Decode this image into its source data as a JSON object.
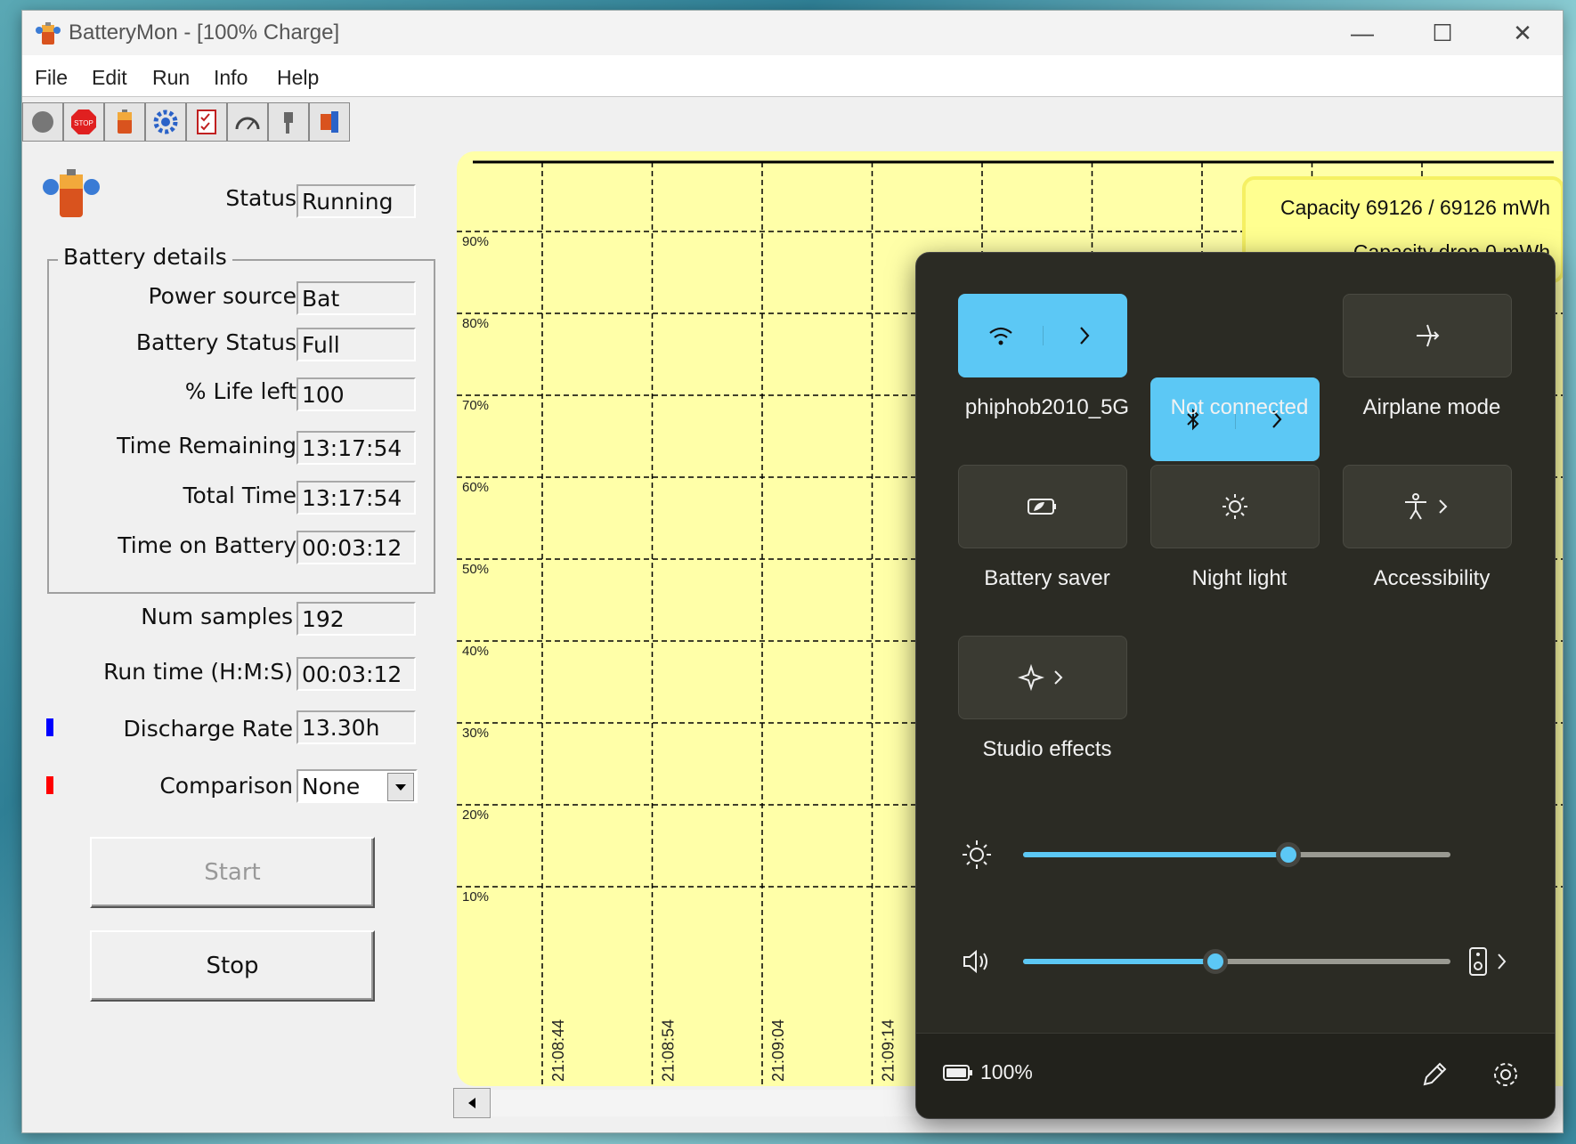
{
  "window": {
    "title": "BatteryMon - [100% Charge]",
    "controls": {
      "minimize": "—",
      "maximize": "☐",
      "close": "✕"
    }
  },
  "menu": {
    "items": [
      "File",
      "Edit",
      "Run",
      "Info",
      "Help"
    ]
  },
  "toolbar": {
    "buttons": [
      "stop-circle-icon",
      "stop-sign-icon",
      "battery-icon",
      "settings-icon",
      "checklist-icon",
      "gauge-icon",
      "plug-icon",
      "tools-icon"
    ]
  },
  "panel": {
    "status_label": "Status",
    "status_value": "Running",
    "group_title": "Battery details",
    "power_source_label": "Power source",
    "power_source_value": "Bat",
    "battery_status_label": "Battery Status",
    "battery_status_value": "Full",
    "life_left_label": "% Life left",
    "life_left_value": "100",
    "time_remaining_label": "Time Remaining",
    "time_remaining_value": "13:17:54",
    "total_time_label": "Total Time",
    "total_time_value": "13:17:54",
    "time_on_battery_label": "Time on Battery",
    "time_on_battery_value": "00:03:12",
    "num_samples_label": "Num samples",
    "num_samples_value": "192",
    "run_time_label": "Run time (H:M:S)",
    "run_time_value": "00:03:12",
    "discharge_rate_label": "Discharge Rate",
    "discharge_rate_value": "13.30h",
    "comparison_label": "Comparison",
    "comparison_value": "None",
    "start_label": "Start",
    "stop_label": "Stop",
    "discharge_color": "#0000ff",
    "comparison_color": "#ff0000"
  },
  "chart": {
    "y_ticks": [
      "90%",
      "80%",
      "70%",
      "60%",
      "50%",
      "40%",
      "30%",
      "20%",
      "10%"
    ],
    "x_ticks": [
      "21:08:44",
      "21:08:54",
      "21:09:04",
      "21:09:14"
    ],
    "info_capacity": "Capacity 69126 / 69126 mWh",
    "info_drop": "Capacity drop 0 mWh",
    "background": "#ffffa8"
  },
  "quick_settings": {
    "wifi_label": "phiphob2010_5G",
    "bluetooth_label": "Not connected",
    "airplane_label": "Airplane mode",
    "battery_saver_label": "Battery saver",
    "night_light_label": "Night light",
    "accessibility_label": "Accessibility",
    "studio_effects_label": "Studio effects",
    "brightness_level": 0.62,
    "volume_level": 0.45,
    "battery_percent": "100%",
    "accent": "#5cc8f5"
  }
}
